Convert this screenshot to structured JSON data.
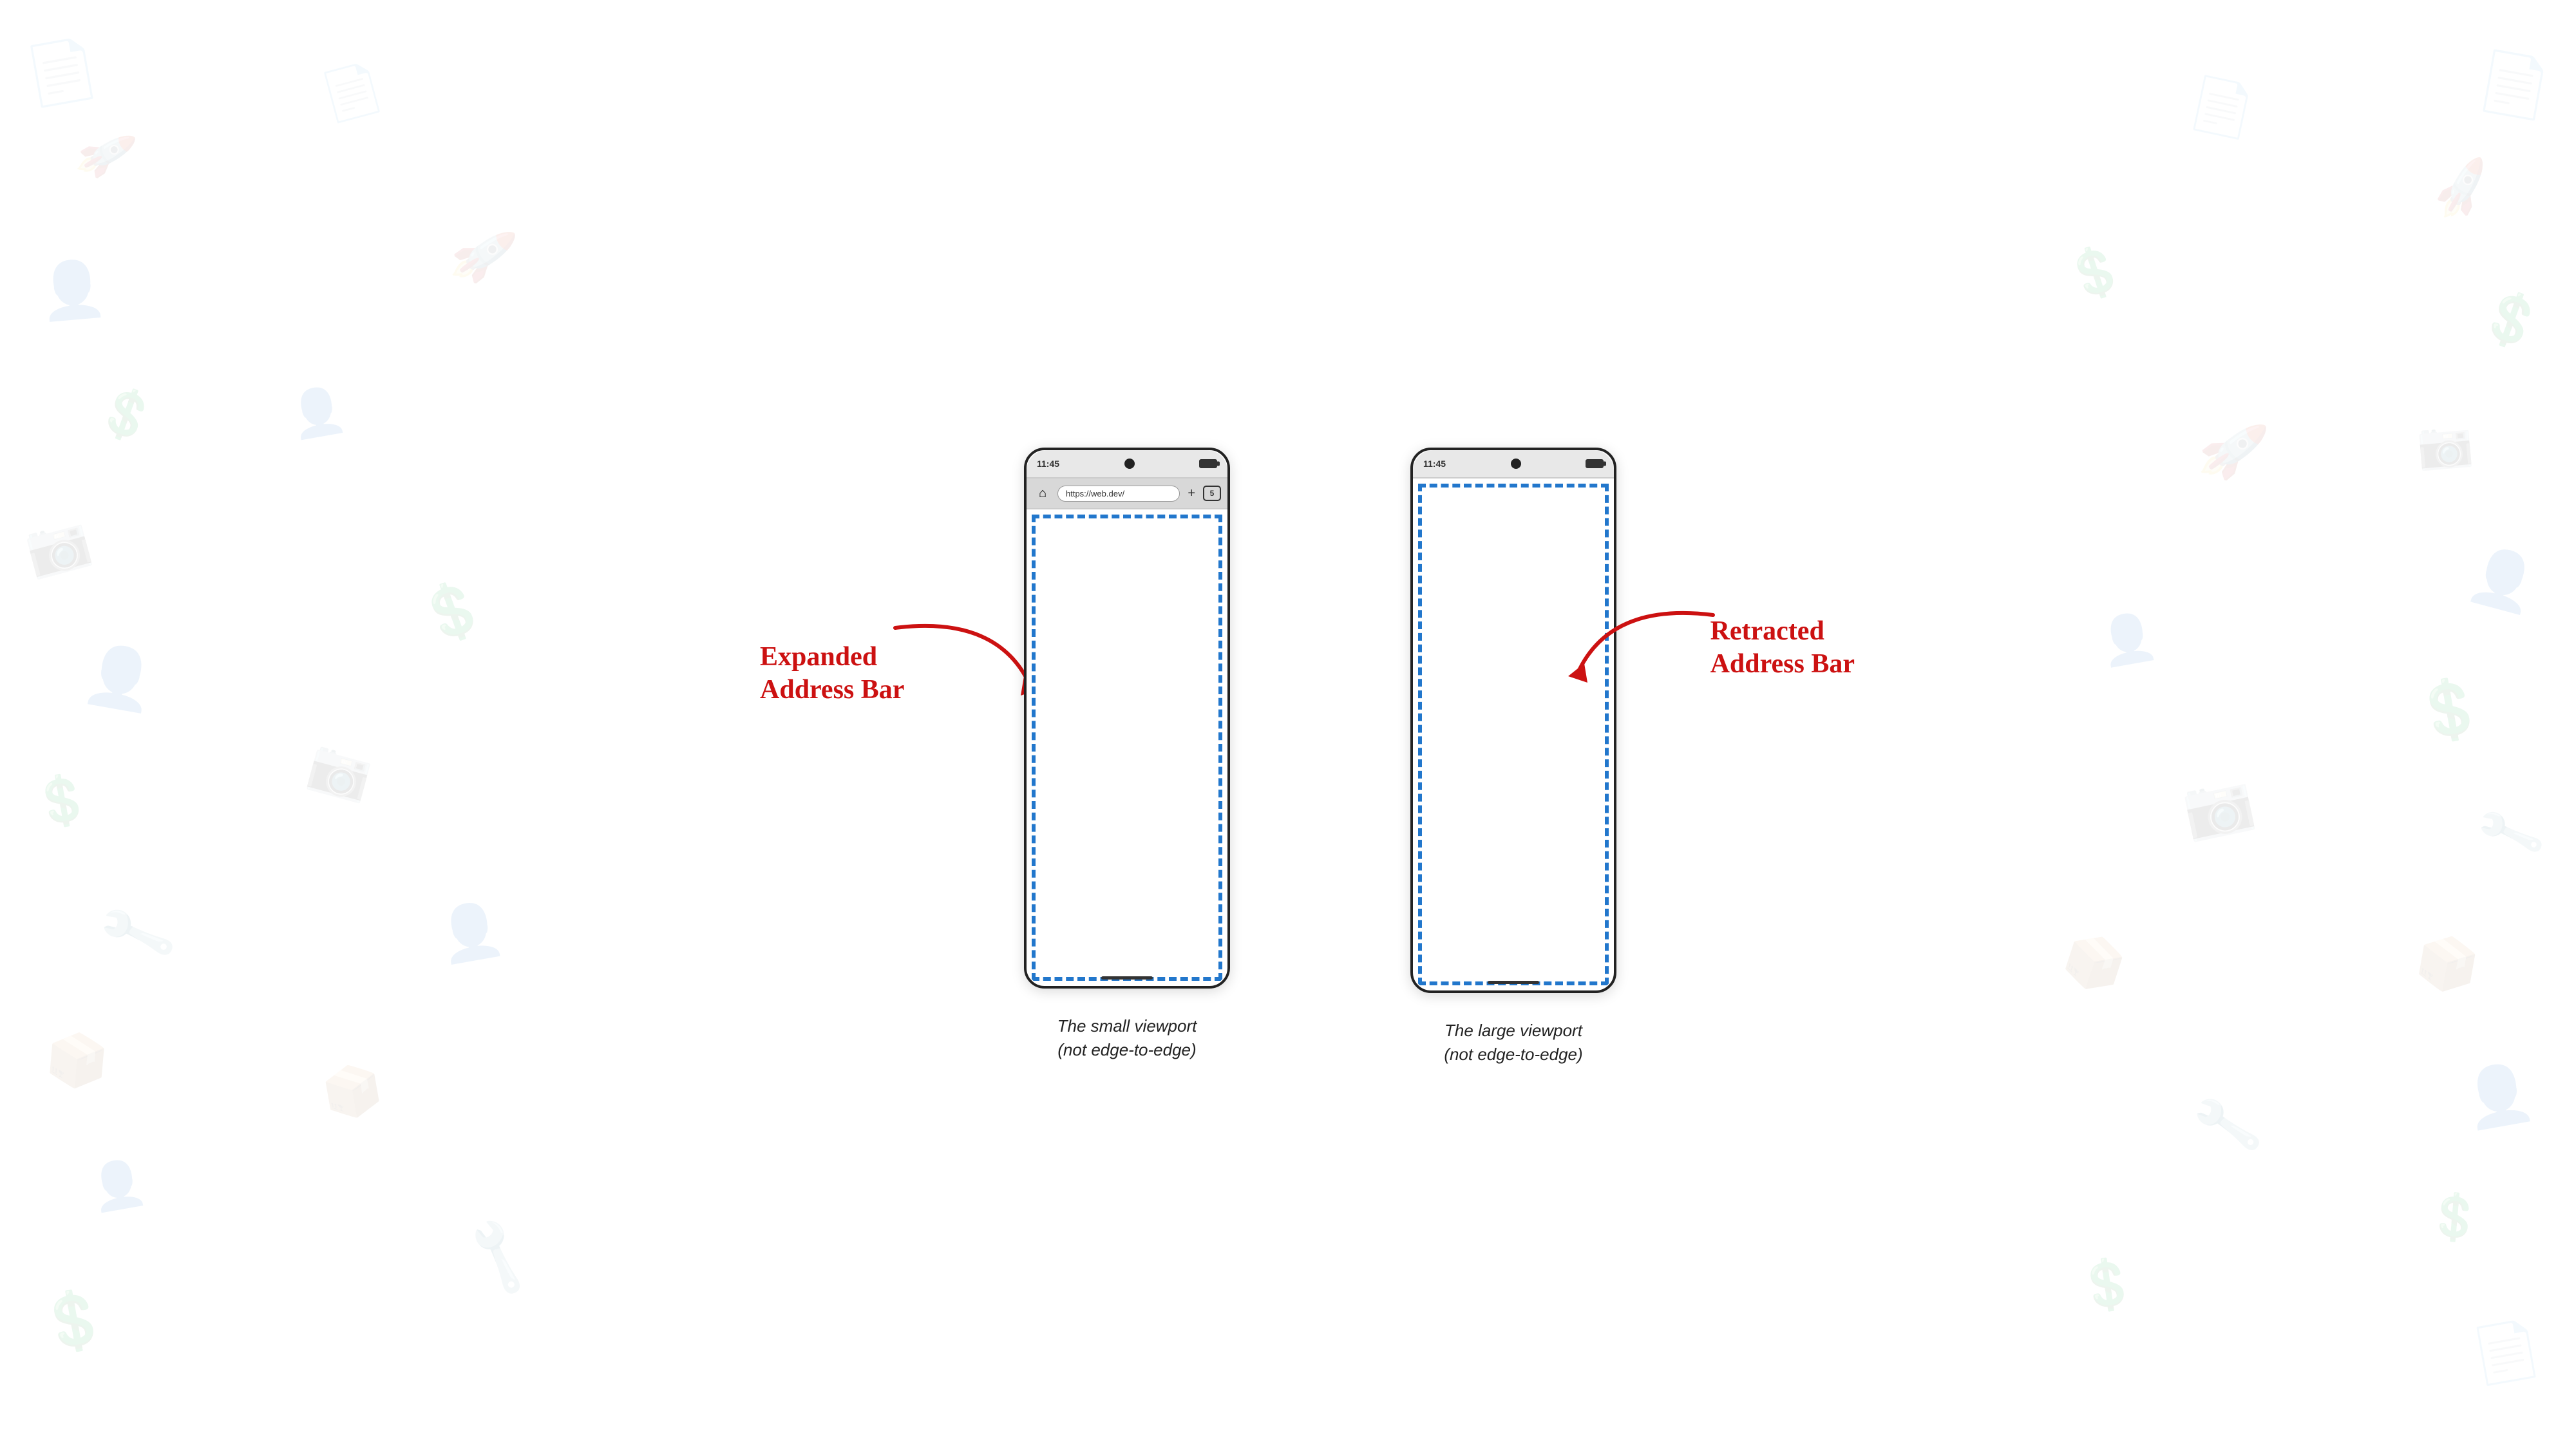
{
  "background": {
    "color": "#ffffff"
  },
  "left_phone": {
    "status_bar": {
      "time": "11:45",
      "has_camera": true
    },
    "address_bar": {
      "url": "https://web.dev/",
      "plus_label": "+",
      "tabs_count": "5"
    },
    "content_height": 820,
    "viewport": {
      "top": 0,
      "left": 0,
      "right": 0,
      "bottom": 0
    },
    "label_line1": "The small viewport",
    "label_line2": "(not edge-to-edge)"
  },
  "right_phone": {
    "status_bar": {
      "time": "11:45",
      "has_camera": true
    },
    "content_height": 875,
    "label_line1": "The large viewport",
    "label_line2": "(not edge-to-edge)"
  },
  "left_annotation": {
    "line1": "Expanded",
    "line2": "Address Bar"
  },
  "right_annotation": {
    "line1": "Retracted",
    "line2": "Address Bar"
  },
  "icons": {
    "home": "⌂",
    "battery_full": "🔋"
  }
}
